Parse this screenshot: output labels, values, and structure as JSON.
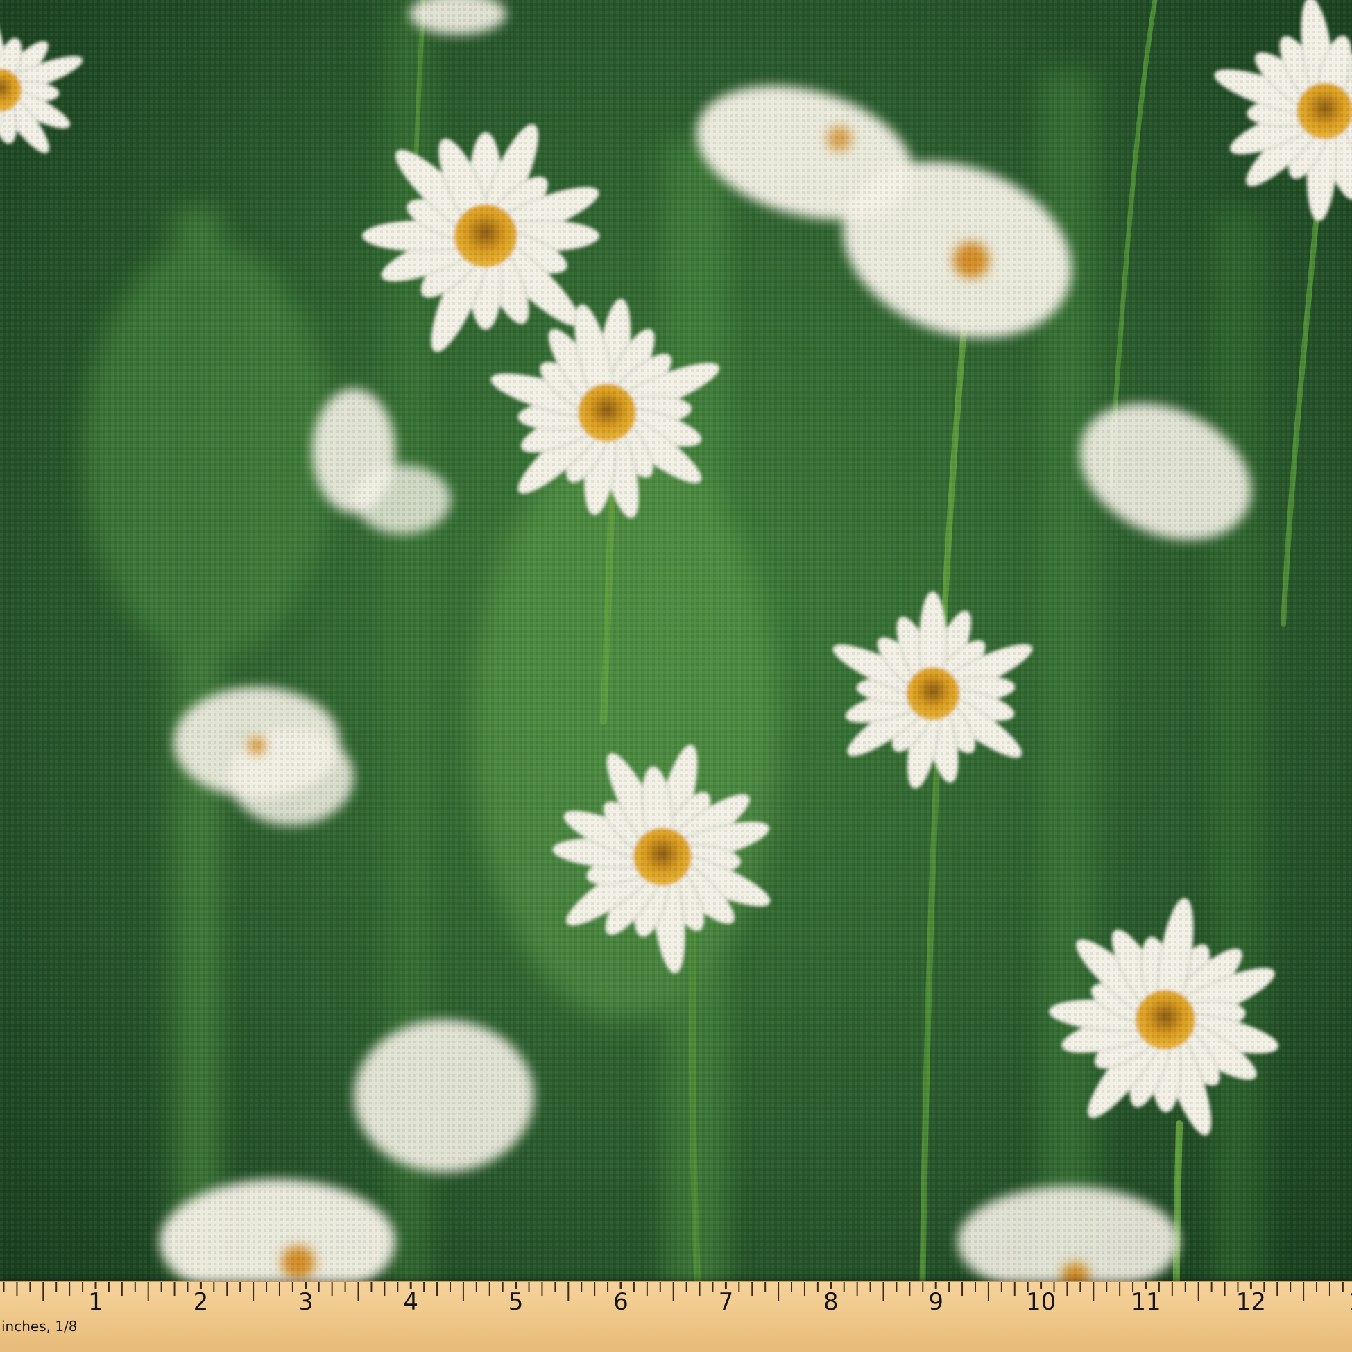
{
  "scene": {
    "background_color": "#234a2a",
    "petal_color": "#f3f1e6",
    "center_color": "#d89b1f"
  },
  "ruler": {
    "unit_label": "inches, 1/8",
    "numbers": [
      "1",
      "2",
      "3",
      "4",
      "5",
      "6",
      "7",
      "8",
      "9",
      "10",
      "11",
      "12",
      "1"
    ],
    "color": "#f1c98b"
  }
}
